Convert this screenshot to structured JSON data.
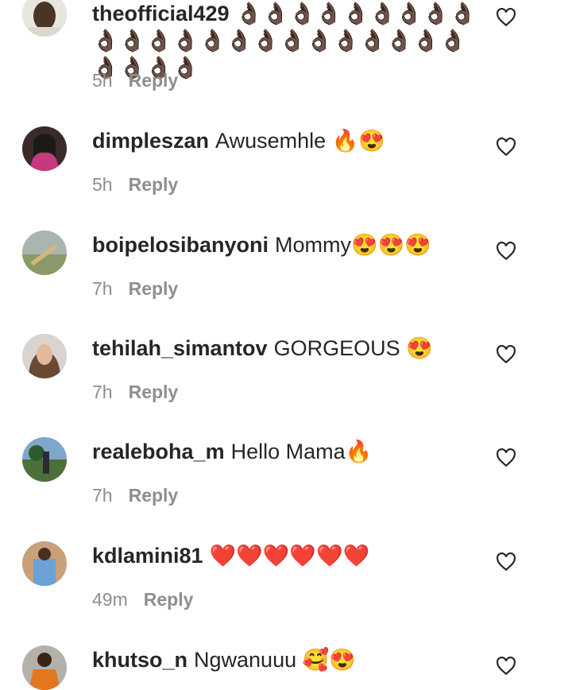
{
  "comments": [
    {
      "username": "theofficial429",
      "text": "👌🏿👌🏿👌🏿👌🏿👌🏿👌🏿👌🏿👌🏿👌🏿👌🏿👌🏿👌🏿👌🏿👌🏿👌🏿👌🏿👌🏿👌🏿👌🏿👌🏿👌🏿👌🏿👌🏿👌🏿👌🏿👌🏿👌🏿",
      "time": "5h",
      "reply": "Reply"
    },
    {
      "username": "dimpleszan",
      "text": "Awusemhle 🔥😍",
      "time": "5h",
      "reply": "Reply"
    },
    {
      "username": "boipelosibanyoni",
      "text": "Mommy😍😍😍",
      "time": "7h",
      "reply": "Reply"
    },
    {
      "username": "tehilah_simantov",
      "text": "GORGEOUS 😍",
      "time": "7h",
      "reply": "Reply"
    },
    {
      "username": "realeboha_m",
      "text": "Hello Mama🔥",
      "time": "7h",
      "reply": "Reply"
    },
    {
      "username": "kdlamini81",
      "text": "❤️❤️❤️❤️❤️❤️",
      "time": "49m",
      "reply": "Reply"
    },
    {
      "username": "khutso_n",
      "text": "Ngwanuuu 🥰😍",
      "time": "",
      "reply": ""
    }
  ],
  "icons": {
    "like": "heart-outline-icon"
  }
}
